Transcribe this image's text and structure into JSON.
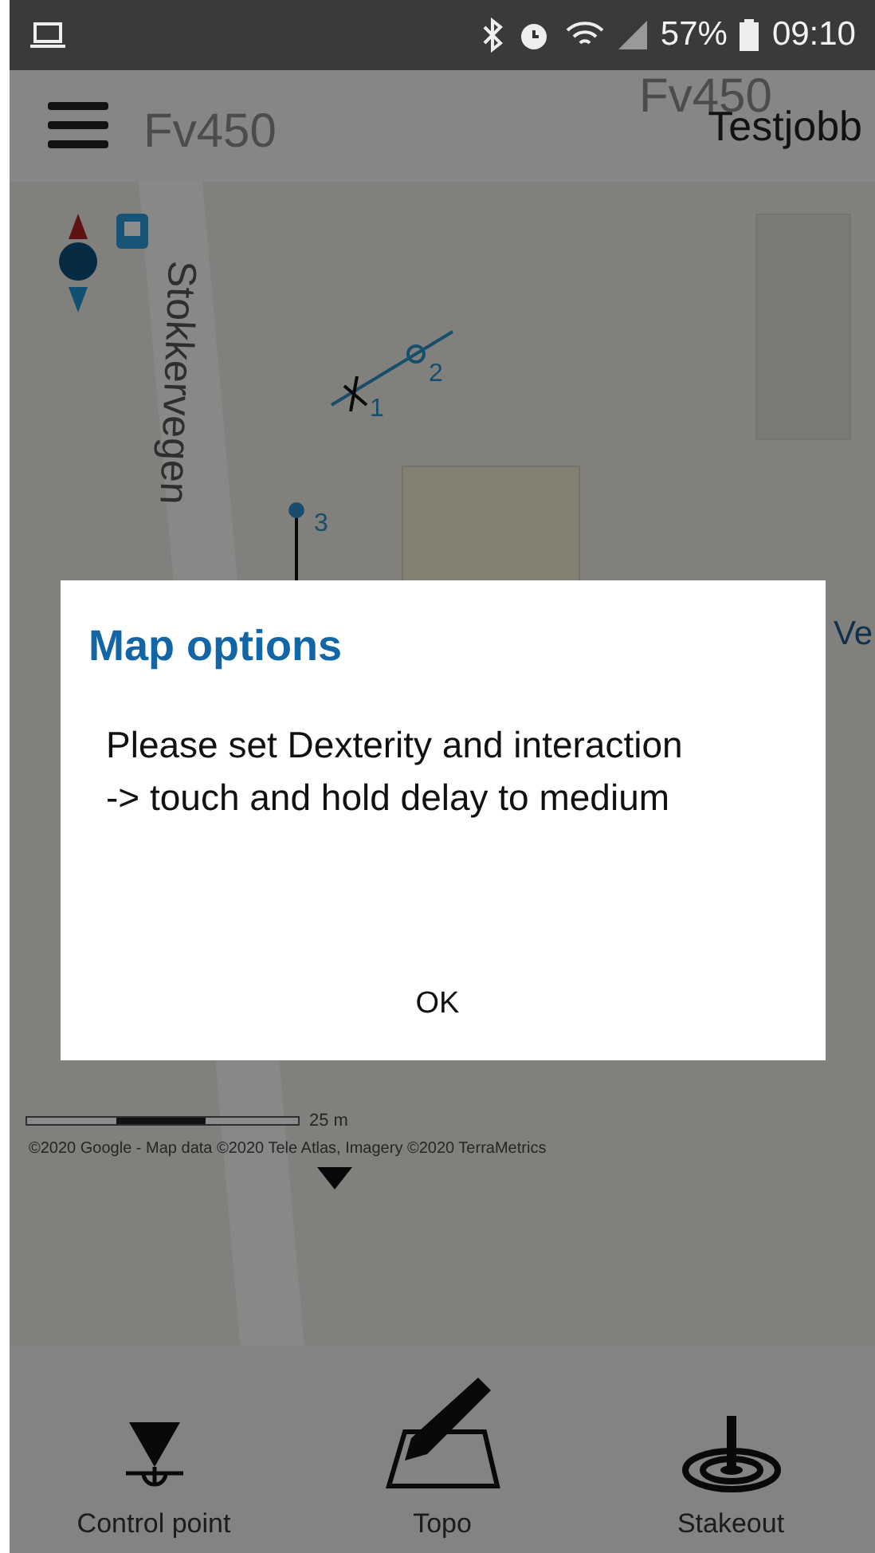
{
  "status_bar": {
    "battery": "57%",
    "time": "09:10"
  },
  "app_bar": {
    "title": "Testjobb"
  },
  "map": {
    "labels": [
      {
        "kind": "road",
        "text": "Fv450"
      },
      {
        "kind": "road-faint",
        "text": "Fv450"
      },
      {
        "kind": "street",
        "text": "Stokkervegen"
      },
      {
        "kind": "edge",
        "text": "Ve"
      }
    ],
    "points": [
      {
        "label": "1"
      },
      {
        "label": "2"
      },
      {
        "label": "3"
      }
    ],
    "scale": "25 m",
    "copyright": "©2020 Google - Map data ©2020 Tele Atlas, Imagery ©2020 TerraMetrics"
  },
  "dialog": {
    "title": "Map options",
    "message": "Please set Dexterity and interaction -> touch and hold delay to medium",
    "buttons": [
      "OK"
    ]
  },
  "toolbar": [
    {
      "kind": "control-point",
      "label": "Control point"
    },
    {
      "kind": "topo",
      "label": "Topo"
    },
    {
      "kind": "stakeout",
      "label": "Stakeout"
    }
  ]
}
